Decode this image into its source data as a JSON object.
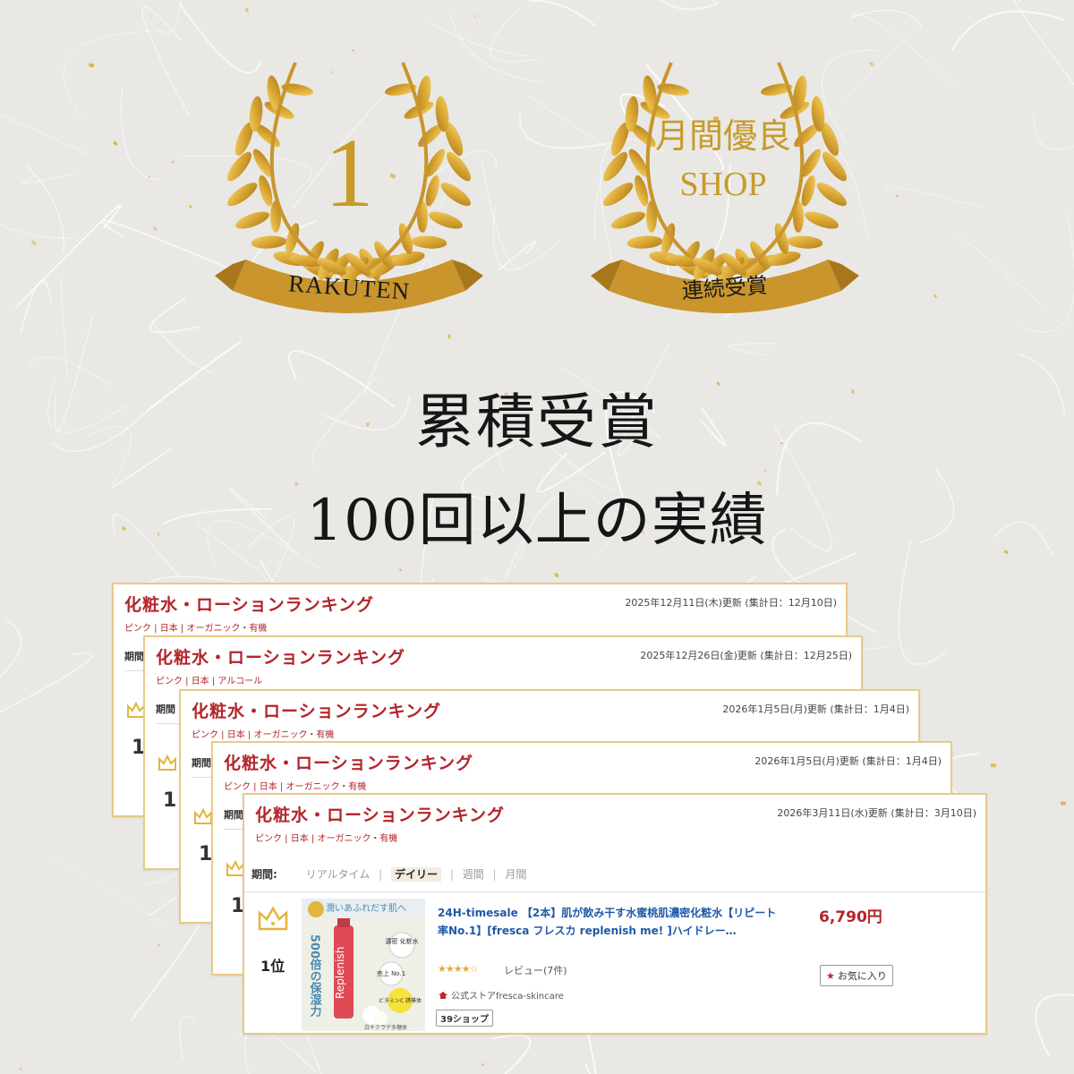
{
  "badges": {
    "left": {
      "number": "1",
      "ribbon": "RAKUTEN"
    },
    "right": {
      "line1": "月間優良",
      "line2": "SHOP",
      "ribbon": "連続受賞"
    }
  },
  "headline": {
    "line1": "累積受賞",
    "line2": "100回以上の実績"
  },
  "colors": {
    "gold": "#c79a2a",
    "ranking_red": "#b3252a",
    "card_border": "#e8c98a",
    "link_blue": "#1d5aa8"
  },
  "cards": [
    {
      "title": "化粧水・ローションランキング",
      "date": "2025年12月11日(木)更新 (集計日：12月10日)",
      "tags": "ピンク | 日本 | オーガニック・有機",
      "peek_label": "期間",
      "peek_num": "1"
    },
    {
      "title": "化粧水・ローションランキング",
      "date": "2025年12月26日(金)更新 (集計日：12月25日)",
      "tags": "ピンク | 日本 | アルコール",
      "peek_label": "期間",
      "peek_num": "1"
    },
    {
      "title": "化粧水・ローションランキング",
      "date": "2026年1月5日(月)更新 (集計日：1月4日)",
      "tags": "ピンク | 日本 | オーガニック・有機",
      "peek_label": "期間",
      "peek_num": "1"
    },
    {
      "title": "化粧水・ローションランキング",
      "date": "2026年1月5日(月)更新 (集計日：1月4日)",
      "tags": "ピンク | 日本 | オーガニック・有機",
      "peek_label": "期間",
      "peek_num": "1"
    },
    {
      "title": "化粧水・ローションランキング",
      "date": "2026年3月11日(水)更新 (集計日：3月10日)",
      "tags": "ピンク | 日本 | オーガニック・有機"
    }
  ],
  "front": {
    "period_label": "期間:",
    "period_options": [
      "リアルタイム",
      "デイリー",
      "週間",
      "月間"
    ],
    "active_period": "デイリー",
    "rank": "1位",
    "product_title": "24H-timesale 【2本】肌が飲み干す水蜜桃肌濃密化粧水【リピート率No.1】[fresca フレスカ replenish me! ]ハイドレー…",
    "price": "6,790円",
    "stars": "★★★★☆",
    "review": "レビュー(7件)",
    "shop": "公式ストアfresca-skincare",
    "points_badge": "39ショップ",
    "favorite": "お気に入り",
    "thumb": {
      "banner": "潤いあふれだす肌へ",
      "tag1": "濃密 化粧水",
      "tag2": "売上 No.1",
      "tag3": "ビタミンC 誘導体",
      "vertical": "500倍の保湿力",
      "brand": "Replenish",
      "footer": "白キクラゲ多糖体"
    }
  }
}
